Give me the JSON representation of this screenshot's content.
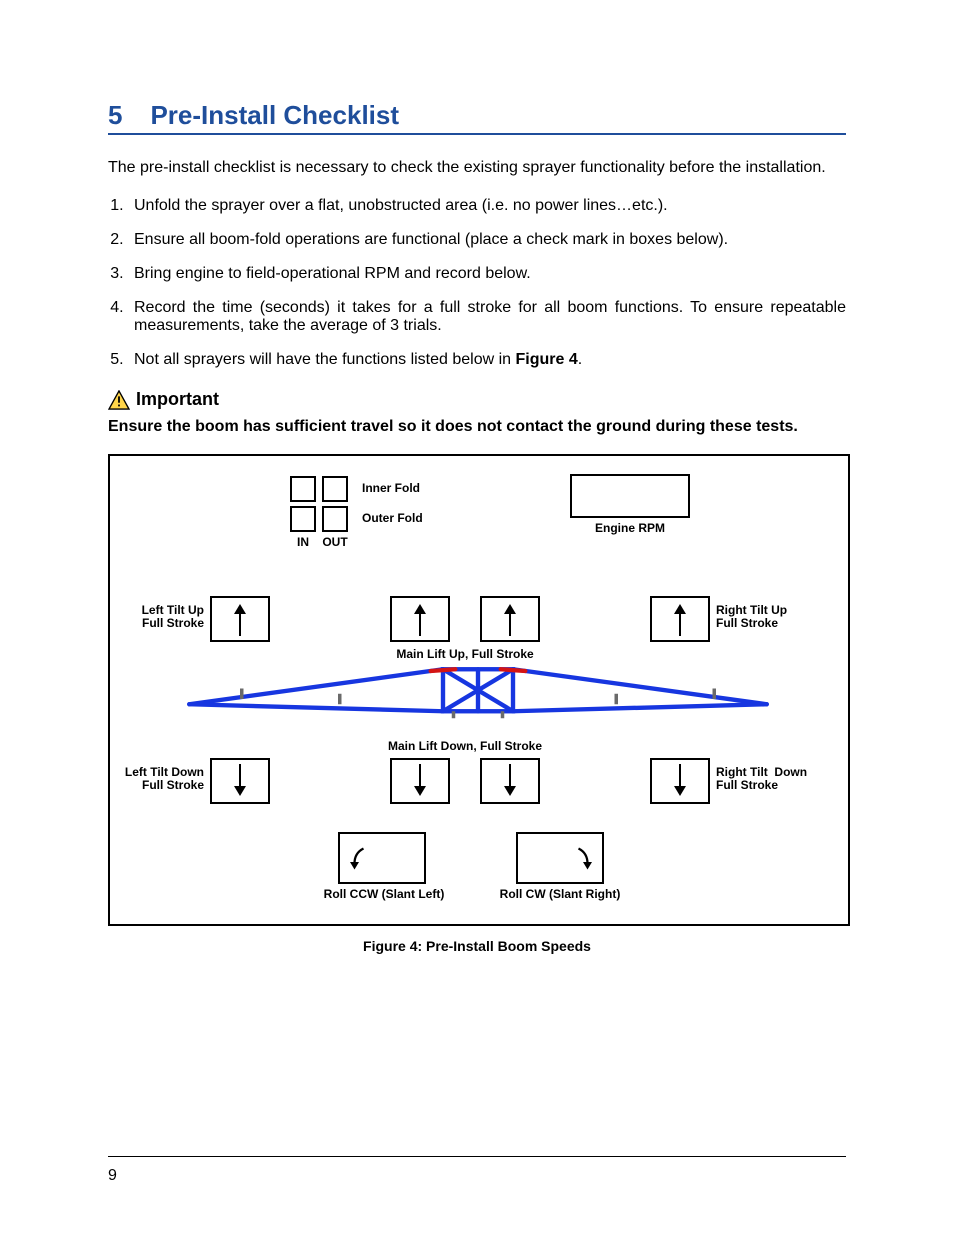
{
  "section": {
    "number": "5",
    "title": "Pre-Install Checklist"
  },
  "intro": "The pre-install checklist is necessary to check the existing sprayer functionality before the installation.",
  "steps": [
    "Unfold the sprayer over a flat, unobstructed area (i.e. no power lines…etc.).",
    "Ensure all boom-fold operations are functional (place a check mark in boxes below).",
    "Bring engine to field-operational RPM and record below.",
    "Record the time (seconds) it takes for a full stroke for all boom functions.  To ensure repeatable measurements, take the average of 3 trials.",
    {
      "pre": "Not all sprayers will have the functions listed below in ",
      "bold": "Figure 4",
      "post": "."
    }
  ],
  "important": {
    "label": "Important",
    "text": "Ensure the boom has sufficient travel so it does not contact the ground during these tests."
  },
  "figure": {
    "fold": {
      "inner": "Inner Fold",
      "outer": "Outer Fold",
      "in": "IN",
      "out": "OUT"
    },
    "engine": "Engine RPM",
    "ltUp": "Left Tilt Up\nFull Stroke",
    "rtUp": "Right Tilt Up\nFull Stroke",
    "mainUp": "Main Lift Up, Full Stroke",
    "mainDn": "Main Lift Down, Full Stroke",
    "ltDn": "Left Tilt Down\nFull Stroke",
    "rtDn": "Right Tilt  Down\nFull Stroke",
    "rollCCW": "Roll CCW (Slant Left)",
    "rollCW": "Roll CW (Slant Right)"
  },
  "caption": "Figure 4: Pre-Install Boom Speeds",
  "pageNumber": "9"
}
